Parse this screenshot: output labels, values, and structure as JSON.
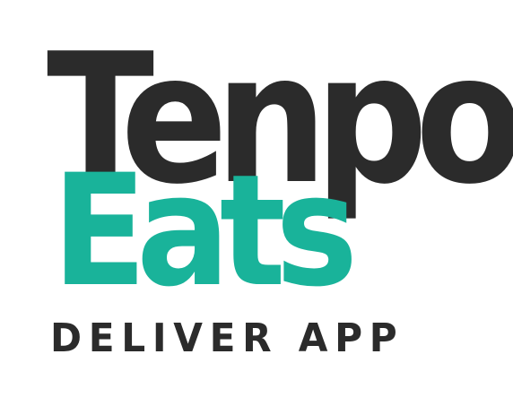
{
  "logo": {
    "line1": "Tenpo",
    "line2": "Eats",
    "tagline": "DELIVER APP"
  },
  "colors": {
    "primary_text": "#2b2b2b",
    "accent": "#19b39a",
    "tagline_text": "#2b2b2b",
    "background": "#ffffff"
  }
}
